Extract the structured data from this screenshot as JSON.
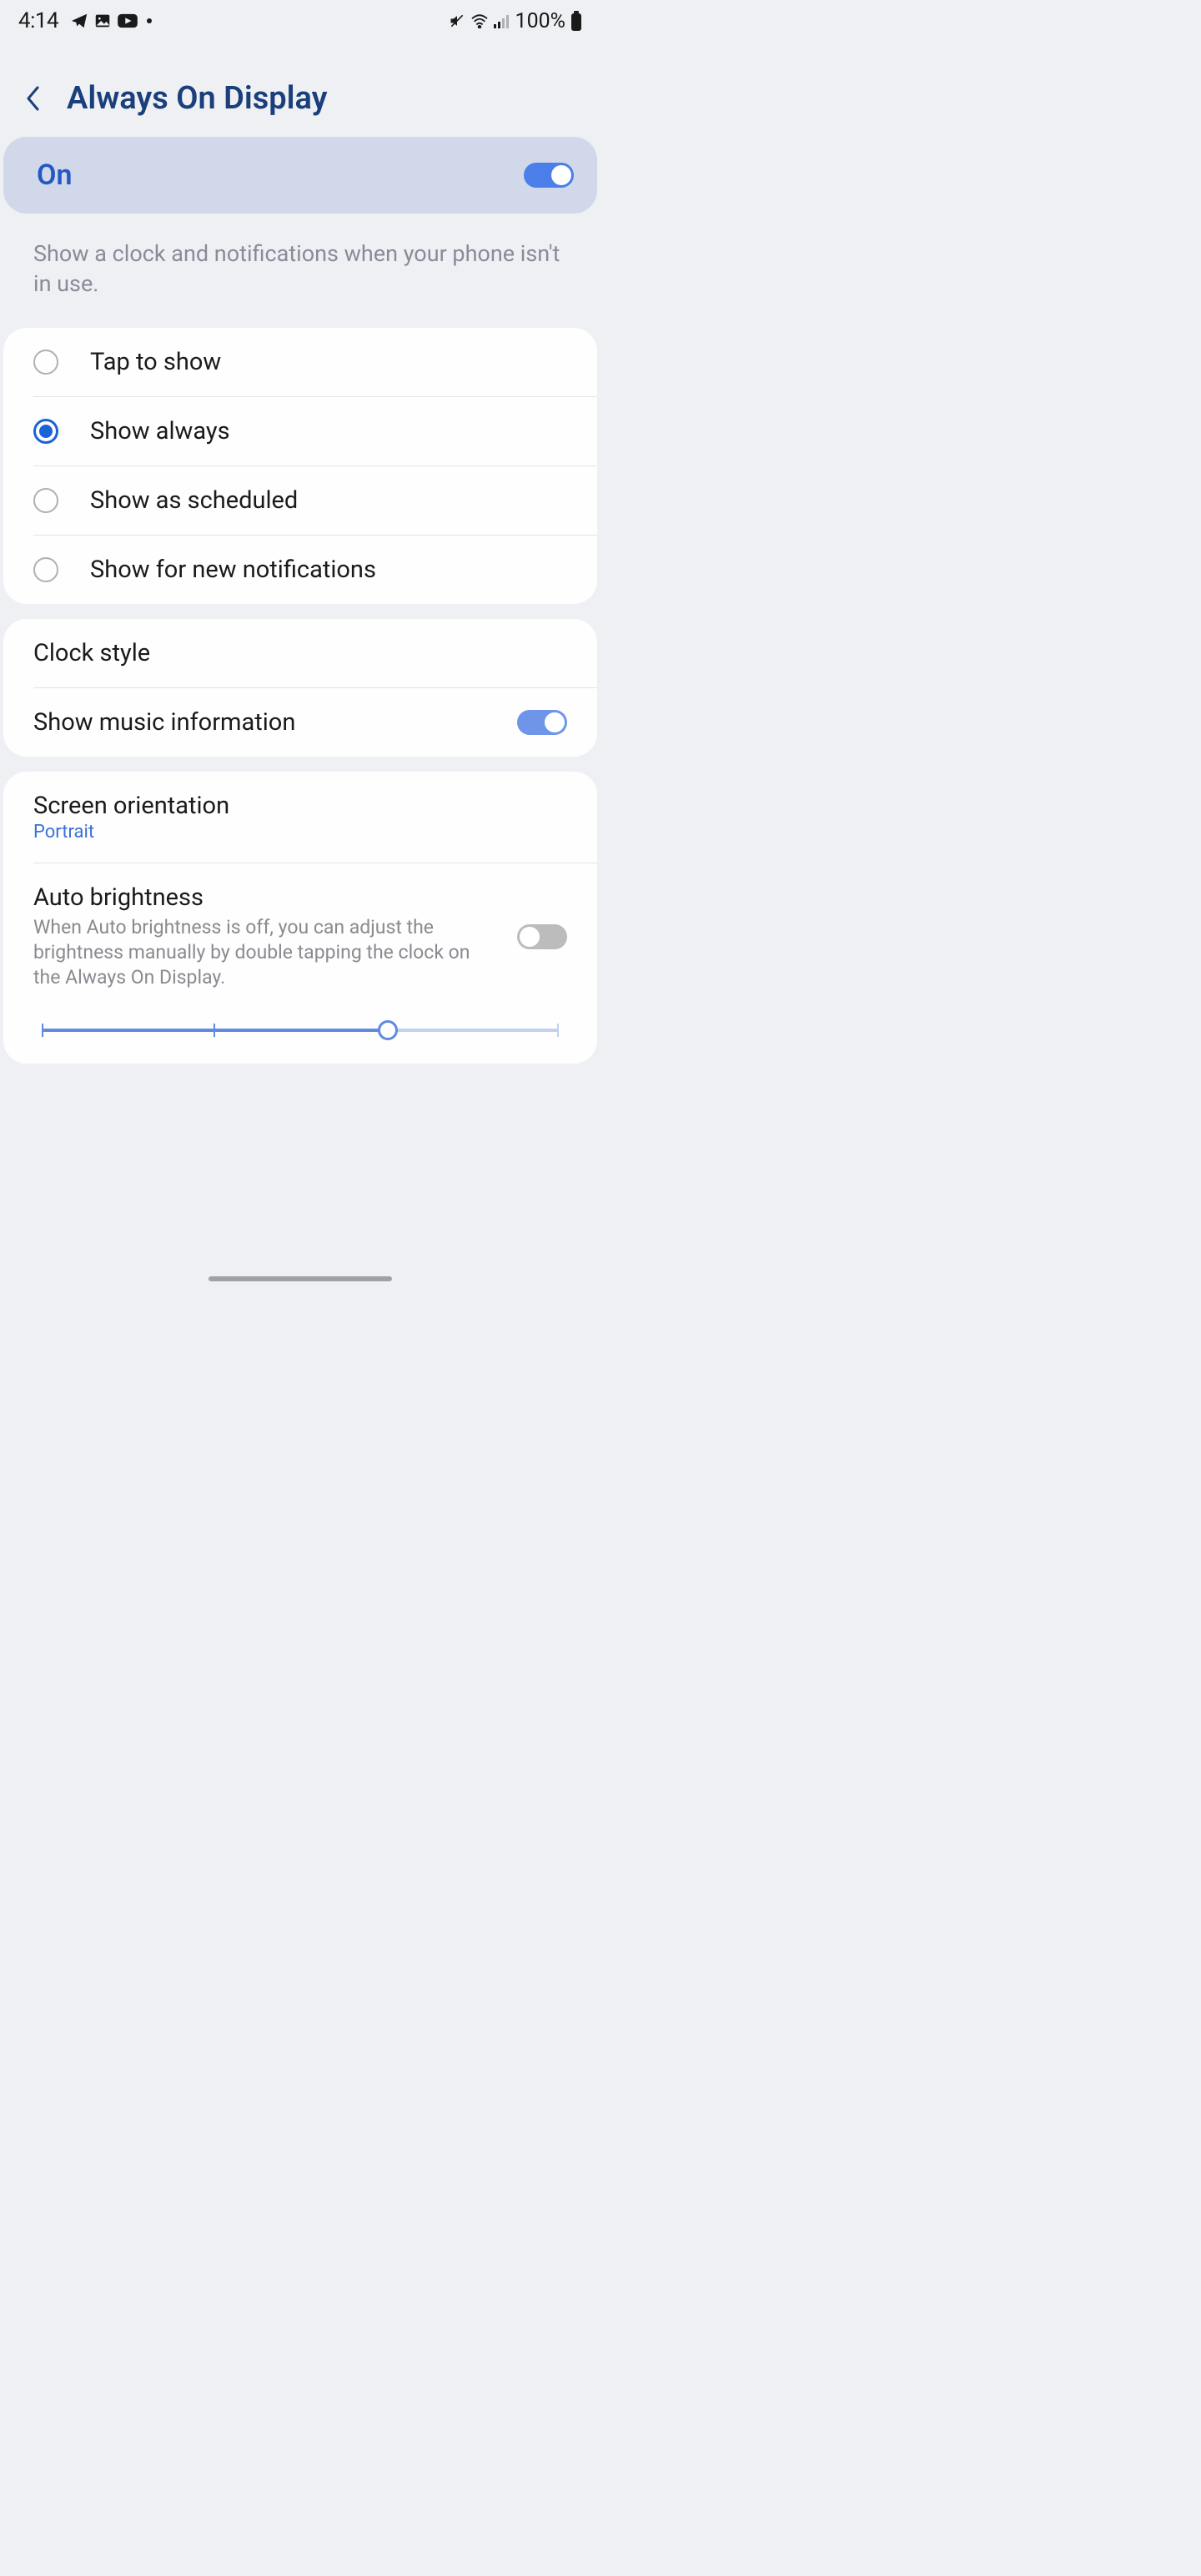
{
  "statusBar": {
    "time": "4:14",
    "battery": "100%"
  },
  "header": {
    "title": "Always On Display"
  },
  "masterToggle": {
    "label": "On",
    "enabled": true
  },
  "description": "Show a clock and notifications when your phone isn't in use.",
  "radioOptions": [
    {
      "label": "Tap to show",
      "selected": false
    },
    {
      "label": "Show always",
      "selected": true
    },
    {
      "label": "Show as scheduled",
      "selected": false
    },
    {
      "label": "Show for new notifications",
      "selected": false
    }
  ],
  "clockCard": {
    "clockStyle": "Clock style",
    "musicInfo": "Show music information",
    "musicEnabled": true
  },
  "screenCard": {
    "orientationLabel": "Screen orientation",
    "orientationValue": "Portrait",
    "autoBrightLabel": "Auto brightness",
    "autoBrightDesc": "When Auto brightness is off, you can adjust the brightness manually by double tapping the clock on the Always On Display.",
    "autoBrightEnabled": false,
    "sliderValue": 67
  }
}
